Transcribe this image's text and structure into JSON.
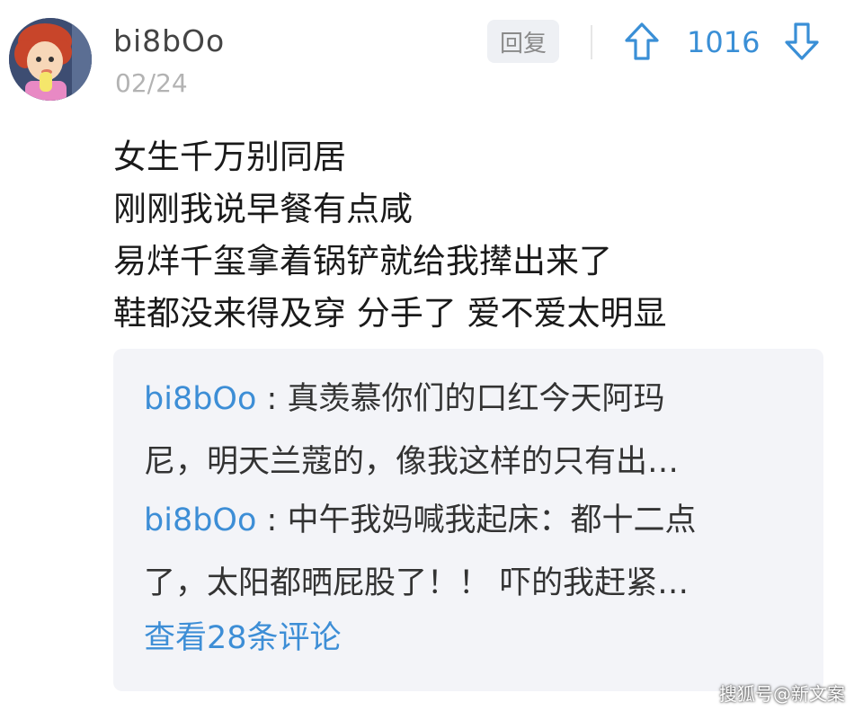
{
  "comment": {
    "username": "bi8bOo",
    "date": "02/24",
    "reply_label": "回复",
    "vote_count": "1016",
    "body_lines": [
      "女生千万别同居",
      "刚刚我说早餐有点咸",
      "易烊千玺拿着锅铲就给我撵出来了",
      "鞋都没来得及穿 分手了 爱不爱太明显"
    ]
  },
  "replies": [
    {
      "author": "bi8bOo",
      "separator": " : ",
      "line1": "真羡慕你们的口红今天阿玛",
      "line2": "尼，明天兰蔻的，像我这样的只有出…"
    },
    {
      "author": "bi8bOo",
      "separator": " : ",
      "line1": "中午我妈喊我起床：都十二点",
      "line2": "了，太阳都晒屁股了！！ 吓的我赶紧…"
    }
  ],
  "view_all_label": "查看28条评论",
  "watermark": "搜狐号@新文案",
  "colors": {
    "accent": "#3d8ed6",
    "reply_bg": "#f3f4f8",
    "muted": "#b3b3b3"
  },
  "icons": {
    "upvote": "arrow-up-outline-icon",
    "downvote": "arrow-down-outline-icon"
  }
}
